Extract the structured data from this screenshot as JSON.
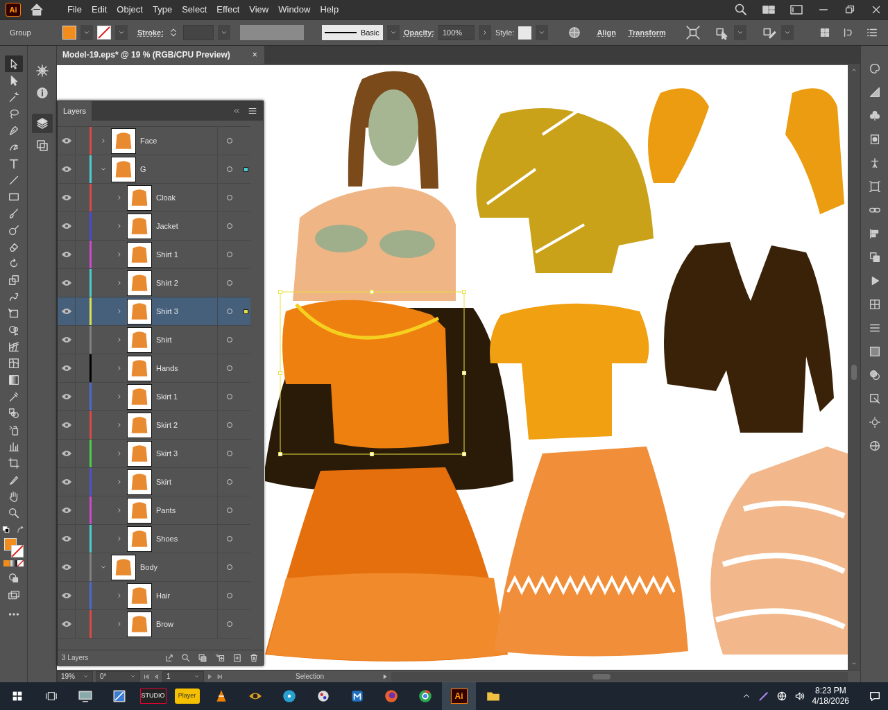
{
  "app": {
    "logo": "Ai"
  },
  "menu": [
    "File",
    "Edit",
    "Object",
    "Type",
    "Select",
    "Effect",
    "View",
    "Window",
    "Help"
  ],
  "control_bar": {
    "selection": "Group",
    "fill": {
      "color": "#f28c1c"
    },
    "stroke_label": "Stroke:",
    "brush": "Basic",
    "opacity_label": "Opacity:",
    "opacity": "100%",
    "style_label": "Style:",
    "align": "Align",
    "transform": "Transform"
  },
  "document_tab": {
    "title": "Model-19.eps* @ 19 % (RGB/CPU Preview)",
    "close": "×"
  },
  "tools": [
    {
      "kind": "selection",
      "selected": true
    },
    {
      "kind": "direct_selection",
      "selected": false
    },
    {
      "kind": "magic_wand",
      "selected": false
    },
    {
      "kind": "lasso",
      "selected": false
    },
    {
      "kind": "pen",
      "selected": false
    },
    {
      "kind": "curvature",
      "selected": false
    },
    {
      "kind": "type",
      "selected": false
    },
    {
      "kind": "line",
      "selected": false
    },
    {
      "kind": "rectangle",
      "selected": false
    },
    {
      "kind": "paintbrush",
      "selected": false
    },
    {
      "kind": "shaper",
      "selected": false
    },
    {
      "kind": "eraser",
      "selected": false
    },
    {
      "kind": "rotate",
      "selected": false
    },
    {
      "kind": "scale",
      "selected": false
    },
    {
      "kind": "warp",
      "selected": false
    },
    {
      "kind": "free_transform",
      "selected": false
    },
    {
      "kind": "shape_builder",
      "selected": false
    },
    {
      "kind": "perspective",
      "selected": false
    },
    {
      "kind": "mesh",
      "selected": false
    },
    {
      "kind": "gradient",
      "selected": false
    },
    {
      "kind": "eyedropper",
      "selected": false
    },
    {
      "kind": "blend",
      "selected": false
    },
    {
      "kind": "sprayer",
      "selected": false
    },
    {
      "kind": "graph",
      "selected": false
    },
    {
      "kind": "artboard",
      "selected": false
    },
    {
      "kind": "slice",
      "selected": false
    },
    {
      "kind": "hand",
      "selected": false
    },
    {
      "kind": "zoom",
      "selected": false
    }
  ],
  "panel_strip": [
    {
      "kind": "properties",
      "selected": false
    },
    {
      "kind": "info",
      "selected": false
    },
    {
      "kind": "layers",
      "selected": true
    },
    {
      "kind": "artboards",
      "selected": false
    }
  ],
  "layers_panel": {
    "title": "Layers",
    "layers": [
      {
        "name": "Face",
        "color": "#e04848",
        "visible": true,
        "expanded": false,
        "selected": false,
        "has_selected_art": false
      },
      {
        "name": "G",
        "color": "#48d0d0",
        "visible": true,
        "expanded": true,
        "selected": false,
        "has_selected_art": true,
        "children": [
          {
            "name": "Cloak",
            "color": "#e04848",
            "visible": true,
            "expanded": false,
            "selected": false,
            "has_selected_art": false
          },
          {
            "name": "Jacket",
            "color": "#4b4bd0",
            "visible": true,
            "expanded": false,
            "selected": false,
            "has_selected_art": false
          },
          {
            "name": "Shirt 1",
            "color": "#d048d0",
            "visible": true,
            "expanded": false,
            "selected": false,
            "has_selected_art": false
          },
          {
            "name": "Shirt 2",
            "color": "#48d0c8",
            "visible": true,
            "expanded": false,
            "selected": false,
            "has_selected_art": false
          },
          {
            "name": "Shirt 3",
            "color": "#e0e048",
            "visible": true,
            "expanded": false,
            "selected": true,
            "has_selected_art": true
          },
          {
            "name": "Shirt",
            "color": "#808080",
            "visible": true,
            "expanded": false,
            "selected": false,
            "has_selected_art": false
          },
          {
            "name": "Hands",
            "color": "#000000",
            "visible": true,
            "expanded": false,
            "selected": false,
            "has_selected_art": false
          },
          {
            "name": "Skirt 1",
            "color": "#4b6ad0",
            "visible": true,
            "expanded": false,
            "selected": false,
            "has_selected_art": false
          },
          {
            "name": "Skirt 2",
            "color": "#e04848",
            "visible": true,
            "expanded": false,
            "selected": false,
            "has_selected_art": false
          },
          {
            "name": "Skirt 3",
            "color": "#48d048",
            "visible": true,
            "expanded": false,
            "selected": false,
            "has_selected_art": false
          },
          {
            "name": "Skirt",
            "color": "#5050d0",
            "visible": true,
            "expanded": false,
            "selected": false,
            "has_selected_art": false
          },
          {
            "name": "Pants",
            "color": "#d048d0",
            "visible": true,
            "expanded": false,
            "selected": false,
            "has_selected_art": false
          },
          {
            "name": "Shoes",
            "color": "#48d0d0",
            "visible": true,
            "expanded": false,
            "selected": false,
            "has_selected_art": false
          }
        ]
      },
      {
        "name": "Body",
        "color": "#808080",
        "visible": true,
        "expanded": true,
        "selected": false,
        "has_selected_art": false,
        "children": [
          {
            "name": "Hair",
            "color": "#4b6ad0",
            "visible": true,
            "expanded": false,
            "selected": false,
            "has_selected_art": false
          },
          {
            "name": "Brow",
            "color": "#e04848",
            "visible": true,
            "expanded": false,
            "selected": false,
            "has_selected_art": false
          }
        ]
      }
    ],
    "footer": "3 Layers"
  },
  "status_bar": {
    "zoom": "19%",
    "rotation": "0°",
    "artboard": "1",
    "tool": "Selection"
  },
  "taskbar": {
    "apps": [
      {
        "kind": "monitor",
        "active": false
      },
      {
        "kind": "snip",
        "active": false
      },
      {
        "kind": "studio",
        "label": "STUDIO",
        "active": false
      },
      {
        "kind": "player",
        "label": "Player",
        "active": false
      },
      {
        "kind": "cone",
        "active": false
      },
      {
        "kind": "eye",
        "active": false
      },
      {
        "kind": "disc",
        "active": false
      },
      {
        "kind": "paint",
        "active": false
      },
      {
        "kind": "maxthon",
        "active": false
      },
      {
        "kind": "firefox",
        "active": false
      },
      {
        "kind": "chrome",
        "active": false
      },
      {
        "kind": "illustrator",
        "label": "Ai",
        "active": true
      },
      {
        "kind": "folder",
        "active": false
      }
    ],
    "time": "8:23 PM",
    "date": "4/18/2026"
  }
}
